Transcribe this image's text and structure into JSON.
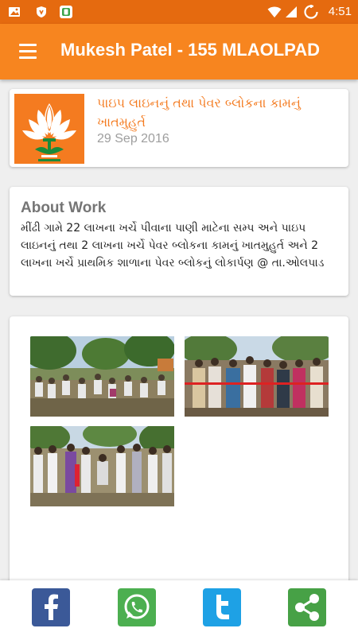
{
  "status_bar": {
    "time": "4:51",
    "icons": [
      "image-icon",
      "shield-icon",
      "phone-app-icon",
      "wifi-icon",
      "signal-icon",
      "battery-icon"
    ]
  },
  "app_bar": {
    "title": "Mukesh Patel - 155 MLAOLPAD",
    "menu_icon": "hamburger-menu-icon"
  },
  "news": {
    "title": "પાઇપ લાઇનનું તથા પેવર બ્લોકના કામનું ખાતમુહુર્ત",
    "date": "29 Sep 2016",
    "logo": "bjp-lotus-logo"
  },
  "about": {
    "heading": "About Work",
    "text": "મીંઢી ગામે 22 લાખના ખર્ચે પીવાના પાણી માટેના સમ્પ અને પાઇપ લાઇનનું તથા 2 લાખના ખર્ચે પેવર બ્લોકના કામનું ખાતમુહુર્ત અને 2 લાખના ખર્ચે પ્રાથમિક શાળાના પેવર બ્લોકનું લોકાર્પણ @ તા.ઓલપાડ"
  },
  "gallery": {
    "photos": [
      "photo-gathering-under-trees",
      "photo-ribbon-cutting",
      "photo-groundbreaking-ceremony"
    ]
  },
  "share": {
    "buttons": [
      "facebook-icon",
      "whatsapp-icon",
      "twitter-icon",
      "share-icon"
    ]
  },
  "colors": {
    "status_bar": "#e56a0f",
    "app_bar": "#f7851f",
    "accent": "#f47b20",
    "facebook": "#3b5998",
    "whatsapp": "#4caf50",
    "twitter": "#1ea1e5",
    "share": "#47a146"
  }
}
